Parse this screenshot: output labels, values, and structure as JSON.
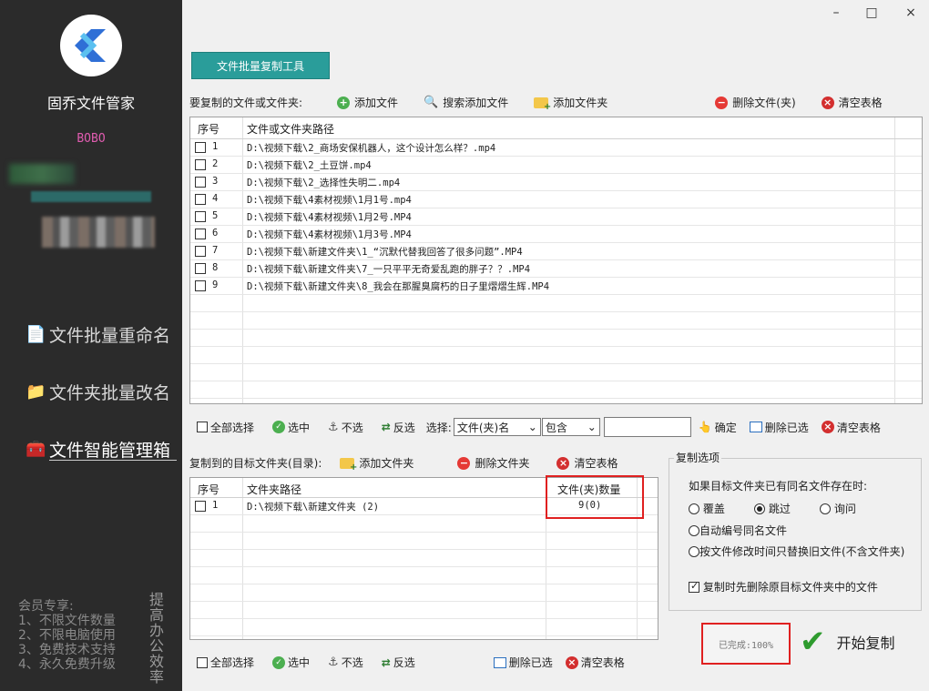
{
  "window": {
    "minimize": "–",
    "maximize": "□",
    "close": "×"
  },
  "sidebar": {
    "app_name": "固乔文件管家",
    "user_name": "BOBO",
    "items": [
      {
        "label": "文件批量重命名",
        "icon": "document-icon"
      },
      {
        "label": "文件夹批量改名",
        "icon": "folder-icon"
      },
      {
        "label": "文件智能管理箱",
        "icon": "toolbox-icon"
      }
    ],
    "member_title": "会员专享:",
    "member_lines": [
      "1、不限文件数量",
      "2、不限电脑使用",
      "3、免费技术支持",
      "4、永久免费升级"
    ],
    "vertical_text": "提高办公效率"
  },
  "tab": {
    "label": "文件批量复制工具"
  },
  "source_toolbar": {
    "title": "要复制的文件或文件夹:",
    "add_file": "添加文件",
    "search_add": "搜索添加文件",
    "add_folder": "添加文件夹",
    "delete": "删除文件(夹)",
    "clear": "清空表格"
  },
  "source_table": {
    "col_index": "序号",
    "col_path": "文件或文件夹路径",
    "rows": [
      {
        "index": "1",
        "path": "D:\\视频下载\\2_商场安保机器人，这个设计怎么样？.mp4"
      },
      {
        "index": "2",
        "path": "D:\\视频下载\\2_土豆饼.mp4"
      },
      {
        "index": "3",
        "path": "D:\\视频下载\\2_选择性失明二.mp4"
      },
      {
        "index": "4",
        "path": "D:\\视频下载\\4素材视频\\1月1号.mp4"
      },
      {
        "index": "5",
        "path": "D:\\视频下载\\4素材视频\\1月2号.MP4"
      },
      {
        "index": "6",
        "path": "D:\\视频下载\\4素材视频\\1月3号.MP4"
      },
      {
        "index": "7",
        "path": "D:\\视频下载\\新建文件夹\\1_“沉默代替我回答了很多问题”.MP4"
      },
      {
        "index": "8",
        "path": "D:\\视频下载\\新建文件夹\\7_一只平平无奇爱乱跑的胖子？？.MP4"
      },
      {
        "index": "9",
        "path": "D:\\视频下载\\新建文件夹\\8_我会在那腥臭腐朽的日子里熠熠生辉.MP4"
      }
    ]
  },
  "source_bottom": {
    "select_all": "全部选择",
    "select": "选中",
    "unselect": "不选",
    "invert": "反选",
    "choose_label": "选择:",
    "filter_field": "文件(夹)名",
    "filter_op": "包含",
    "filter_value": "",
    "confirm": "确定",
    "delete_selected": "删除已选",
    "clear": "清空表格"
  },
  "target_toolbar": {
    "title": "复制到的目标文件夹(目录):",
    "add_folder": "添加文件夹",
    "delete_folder": "删除文件夹",
    "clear": "清空表格"
  },
  "target_table": {
    "col_index": "序号",
    "col_path": "文件夹路径",
    "col_count": "文件(夹)数量",
    "rows": [
      {
        "index": "1",
        "path": "D:\\视频下载\\新建文件夹 (2)",
        "count": "9(0)"
      }
    ]
  },
  "target_bottom": {
    "select_all": "全部选择",
    "select": "选中",
    "unselect": "不选",
    "invert": "反选",
    "delete_selected": "删除已选",
    "clear": "清空表格"
  },
  "copy_options": {
    "legend": "复制选项",
    "question": "如果目标文件夹已有同名文件存在时:",
    "overwrite": "覆盖",
    "skip": "跳过",
    "ask": "询问",
    "auto_number": "自动编号同名文件",
    "replace_old": "按文件修改时间只替换旧文件(不含文件夹)",
    "delete_first": "复制时先删除原目标文件夹中的文件",
    "selected": "skip"
  },
  "progress": {
    "label": "已完成:100%"
  },
  "start": {
    "label": "开始复制"
  }
}
